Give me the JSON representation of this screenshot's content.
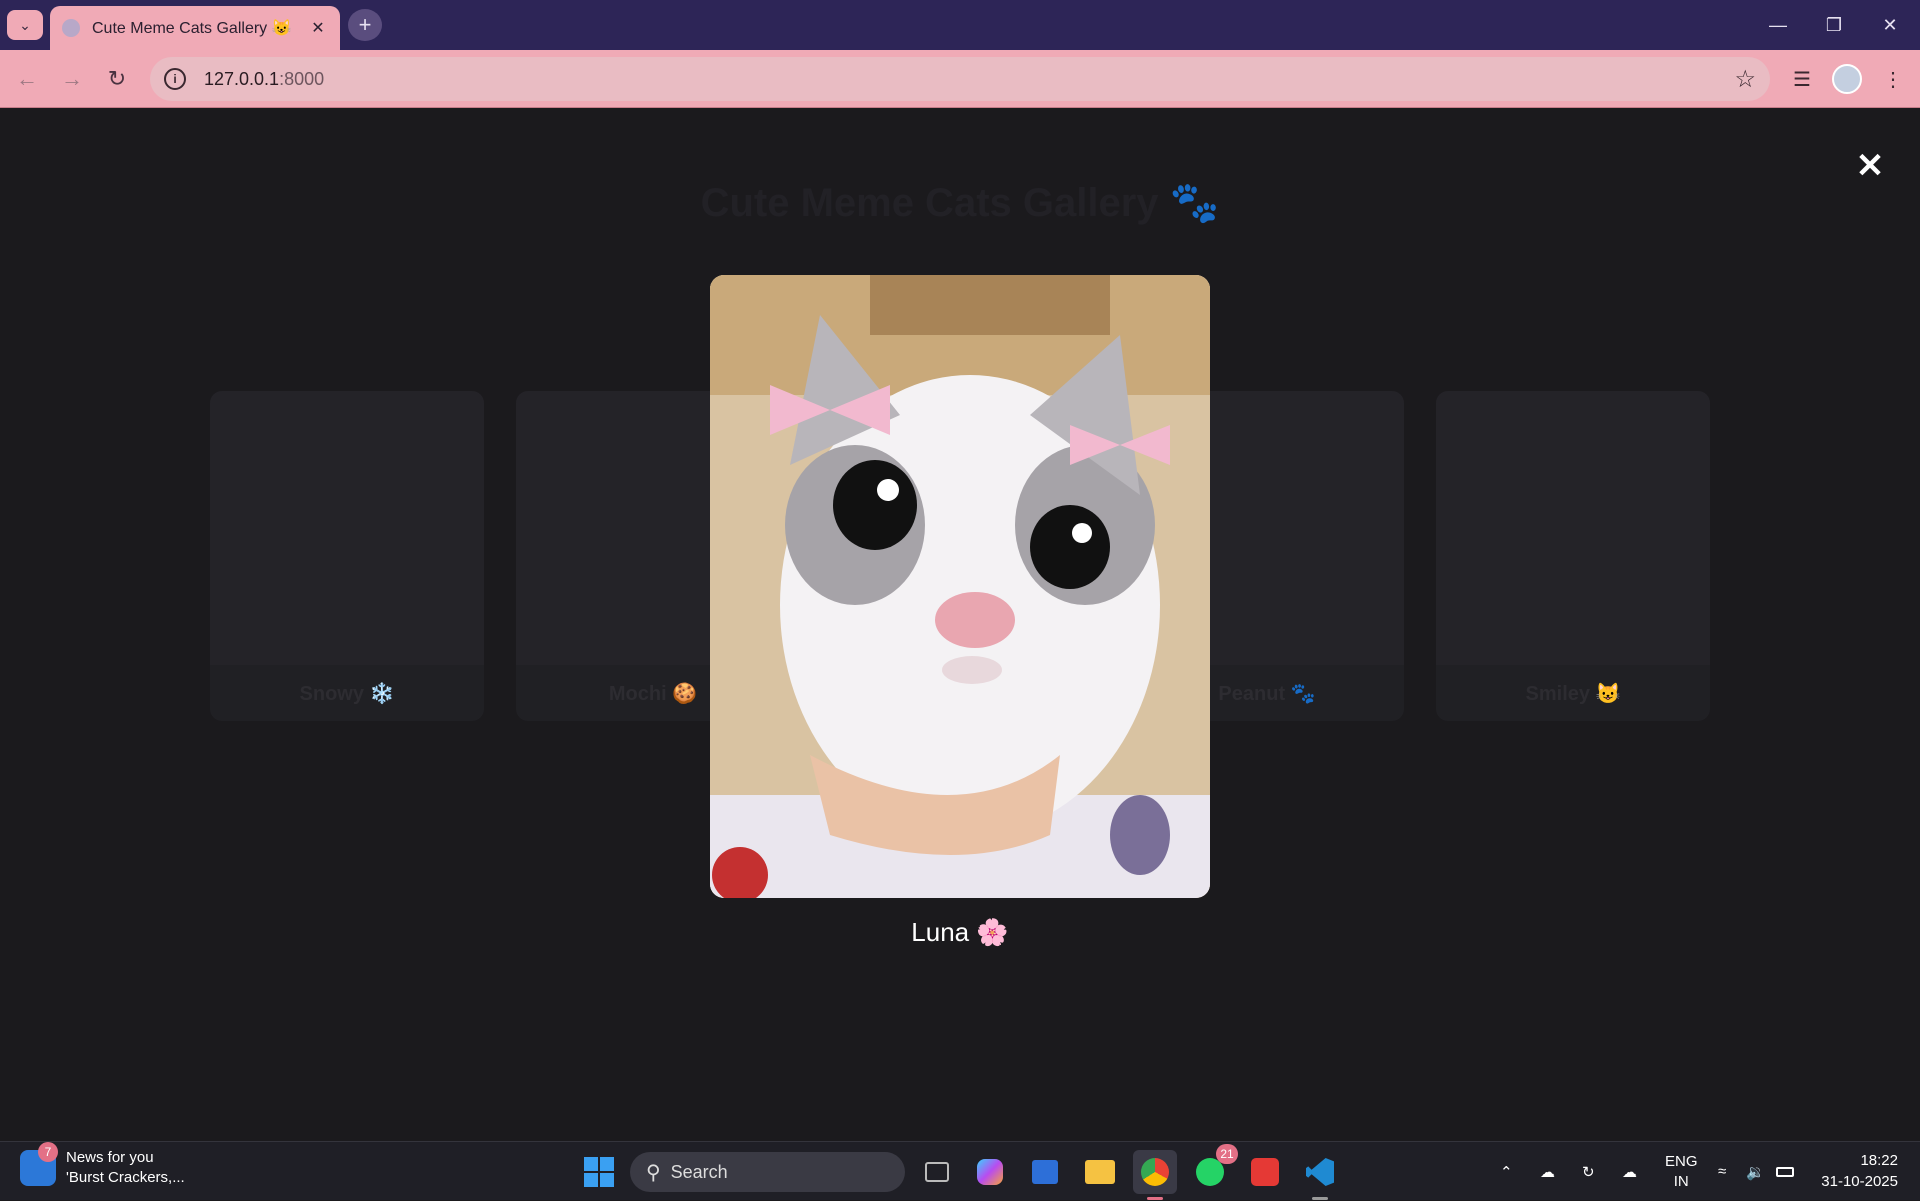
{
  "browser": {
    "tab_title": "Cute Meme Cats Gallery 😺",
    "tab_close": "✕",
    "new_tab": "+",
    "url_host": "127.0.0.1",
    "url_port": ":8000",
    "window_controls": {
      "minimize": "—",
      "restore": "❐",
      "close": "✕"
    }
  },
  "page": {
    "title": "Cute Meme Cats Gallery 🐾",
    "subtitle": "",
    "cards": [
      {
        "name": "Snowy ❄️"
      },
      {
        "name": "Mochi 🍪"
      },
      {
        "name": "Peanut 🐾"
      },
      {
        "name": "Smiley 😺"
      }
    ]
  },
  "modal": {
    "close": "✕",
    "caption": "Luna 🌸"
  },
  "taskbar": {
    "news_badge": "7",
    "news_title": "News for you",
    "news_sub": "'Burst Crackers,...",
    "search_label": "Search",
    "whatsapp_badge": "21",
    "lang_1": "ENG",
    "lang_2": "IN",
    "time": "18:22",
    "date": "31-10-2025"
  },
  "colors": {
    "tab_strip": "#2d2557",
    "toolbar": "#f0aab6",
    "page_bg": "#1b1a1d"
  }
}
